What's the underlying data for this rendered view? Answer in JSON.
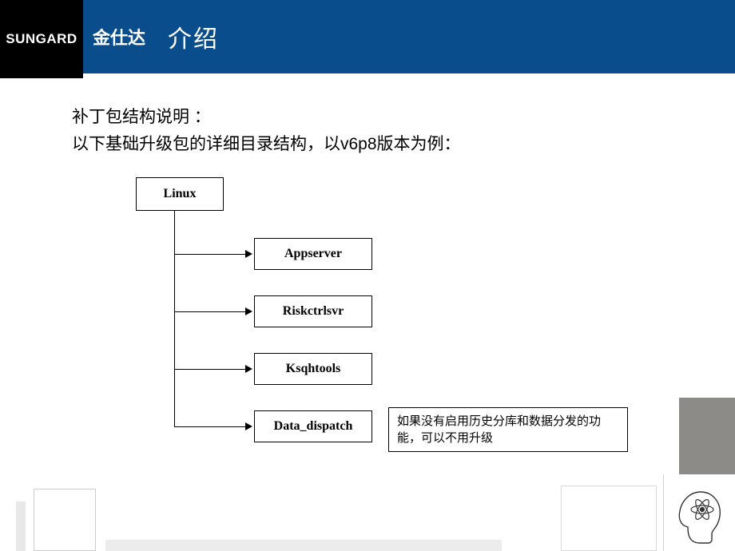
{
  "header": {
    "brand_en": "SUNGARD",
    "brand_cn": "金仕达",
    "title": "介绍"
  },
  "description": {
    "line1": "补丁包结构说明 ：",
    "line2": "以下基础升级包的详细目录结构，以v6p8版本为例："
  },
  "diagram": {
    "root": "Linux",
    "children": [
      "Appserver",
      "Riskctrlsvr",
      "Ksqhtools",
      "Data_dispatch"
    ],
    "note": "如果没有启用历史分库和数据分发的功能，可以不用升级"
  }
}
